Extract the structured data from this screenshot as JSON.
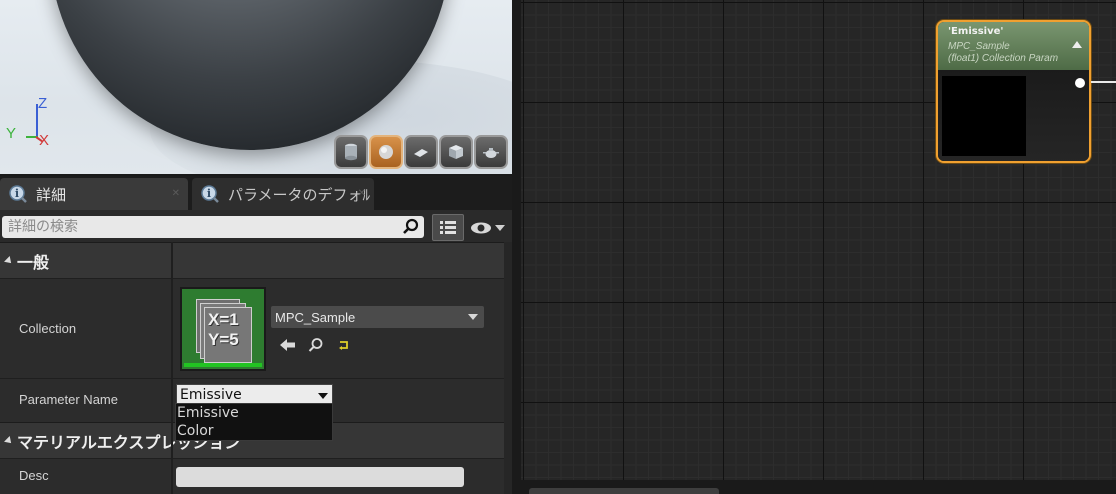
{
  "viewport": {
    "axis_labels": {
      "z": "Z",
      "y": "Y",
      "x": "X"
    },
    "preview_buttons": [
      {
        "name": "cylinder",
        "active": false
      },
      {
        "name": "sphere",
        "active": true
      },
      {
        "name": "plane",
        "active": false
      },
      {
        "name": "cube",
        "active": false
      },
      {
        "name": "teapot",
        "active": false
      }
    ]
  },
  "details": {
    "tabs": [
      {
        "label": "詳細",
        "active": true
      },
      {
        "label": "パラメータのデフォﾙ",
        "active": false
      }
    ],
    "search": {
      "placeholder": "詳細の検索"
    },
    "sections": {
      "general": "一般",
      "material_expression": "マテリアルエクスプレッション"
    },
    "properties": {
      "collection": {
        "label": "Collection",
        "asset": "MPC_Sample",
        "thumbnail_text": [
          "X=1",
          "Y=5"
        ]
      },
      "parameter_name": {
        "label": "Parameter Name",
        "value": "Emissive",
        "options": [
          "Emissive",
          "Color"
        ]
      },
      "desc": {
        "label": "Desc",
        "value": ""
      }
    }
  },
  "graph": {
    "node": {
      "title": "'Emissive'",
      "subtitle_line1": "MPC_Sample",
      "subtitle_line2": "(float1) Collection Param"
    }
  },
  "colors": {
    "node_border": "#f0a030",
    "node_header": "#5d7a55",
    "thumbnail_bg": "#2e7c30",
    "active_preview_button": "#c7793a"
  }
}
